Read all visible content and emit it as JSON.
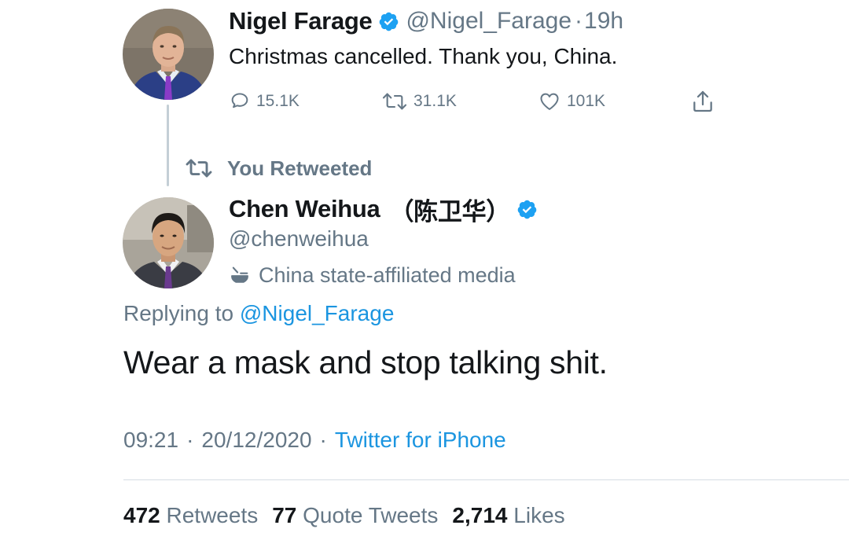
{
  "original_tweet": {
    "author_name": "Nigel Farage",
    "handle": "@Nigel_Farage",
    "separator": "·",
    "time_ago": "19h",
    "text": "Christmas cancelled. Thank you, China.",
    "actions": {
      "reply_count": "15.1K",
      "retweet_count": "31.1K",
      "like_count": "101K"
    },
    "verified": true
  },
  "retweet_context": {
    "label": "You Retweeted"
  },
  "reply_tweet": {
    "author_name": "Chen Weihua",
    "author_name_native": "（陈卫华）",
    "handle": "@chenweihua",
    "verified": true,
    "affiliation_label": "China state-affiliated media",
    "replying_prefix": "Replying to",
    "replying_to": "@Nigel_Farage",
    "text": "Wear a mask and stop talking shit.",
    "time": "09:21",
    "date": "20/12/2020",
    "dot": "·",
    "source": "Twitter for iPhone"
  },
  "stats": {
    "retweets_count": "472",
    "retweets_label": "Retweets",
    "quote_count": "77",
    "quote_label": "Quote Tweets",
    "likes_count": "2,714",
    "likes_label": "Likes"
  },
  "colors": {
    "verified_badge": "#1da1f2",
    "link": "#1b95e0",
    "muted": "#657786",
    "text": "#14171a"
  },
  "icons": {
    "reply": "reply-icon",
    "retweet": "retweet-icon",
    "like": "heart-icon",
    "share": "share-icon",
    "verified": "verified-badge-icon",
    "state_media": "state-media-icon"
  }
}
